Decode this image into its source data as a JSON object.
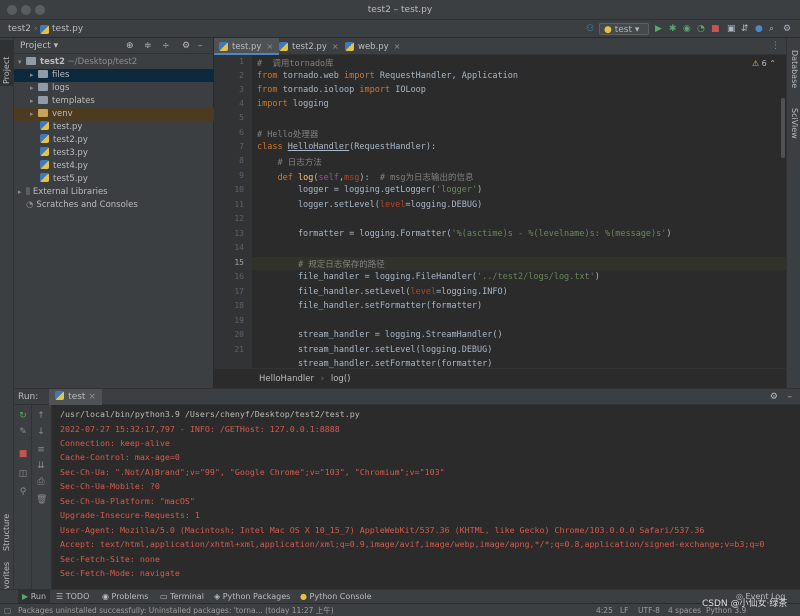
{
  "window": {
    "title": "test2 – test.py"
  },
  "nav": {
    "project": "test2",
    "file": "test.py",
    "run_config": "test"
  },
  "left_stripe": {
    "project": "Project",
    "structure": "Structure",
    "favorites": "Favorites"
  },
  "right_stripe": {
    "database": "Database",
    "sciview": "SciView"
  },
  "project_panel": {
    "title": "Project",
    "root_name": "test2",
    "root_path": "~/Desktop/test2",
    "items": [
      {
        "label": "files",
        "type": "folder"
      },
      {
        "label": "logs",
        "type": "folder"
      },
      {
        "label": "templates",
        "type": "folder"
      },
      {
        "label": "venv",
        "type": "folder-venv"
      },
      {
        "label": "test.py",
        "type": "py"
      },
      {
        "label": "test2.py",
        "type": "py"
      },
      {
        "label": "test3.py",
        "type": "py"
      },
      {
        "label": "test4.py",
        "type": "py"
      },
      {
        "label": "test5.py",
        "type": "py"
      }
    ],
    "external": "External Libraries",
    "scratches": "Scratches and Consoles"
  },
  "editor": {
    "tabs": [
      "test.py",
      "test2.py",
      "web.py"
    ],
    "warning_count": "6",
    "line_numbers": [
      "1",
      "2",
      "3",
      "4",
      "5",
      "6",
      "7",
      "8",
      "9",
      "10",
      "11",
      "12",
      "13",
      "14",
      "15",
      "16",
      "17",
      "18",
      "19",
      "20",
      "21"
    ],
    "breadcrumb": [
      "HelloHandler",
      "log()"
    ]
  },
  "run_panel": {
    "label": "Run:",
    "config": "test",
    "lines": [
      "/usr/local/bin/python3.9 /Users/chenyf/Desktop/test2/test.py",
      "2022-07-27 15:32:17,797 - INFO: /GETHost: 127.0.0.1:8888",
      "Connection: keep-alive",
      "Cache-Control: max-age=0",
      "Sec-Ch-Ua: \".Not/A)Brand\";v=\"99\", \"Google Chrome\";v=\"103\", \"Chromium\";v=\"103\"",
      "Sec-Ch-Ua-Mobile: ?0",
      "Sec-Ch-Ua-Platform: \"macOS\"",
      "Upgrade-Insecure-Requests: 1",
      "User-Agent: Mozilla/5.0 (Macintosh; Intel Mac OS X 10_15_7) AppleWebKit/537.36 (KHTML, like Gecko) Chrome/103.0.0.0 Safari/537.36",
      "Accept: text/html,application/xhtml+xml,application/xml;q=0.9,image/avif,image/webp,image/apng,*/*;q=0.8,application/signed-exchange;v=b3;q=0",
      "Sec-Fetch-Site: none",
      "Sec-Fetch-Mode: navigate"
    ]
  },
  "bottom_tabs": [
    "Run",
    "TODO",
    "Problems",
    "Terminal",
    "Python Packages",
    "Python Console"
  ],
  "event_log": "Event Log",
  "status": {
    "message": "Packages uninstalled successfully: Uninstalled packages: 'torna... (today 11:27 上午)",
    "position": "4:25",
    "line_sep": "LF",
    "encoding": "UTF-8",
    "indent": "4 spaces",
    "interpreter": "Python 3.9",
    "watermark": "CSDN @小仙女·绿茶"
  }
}
